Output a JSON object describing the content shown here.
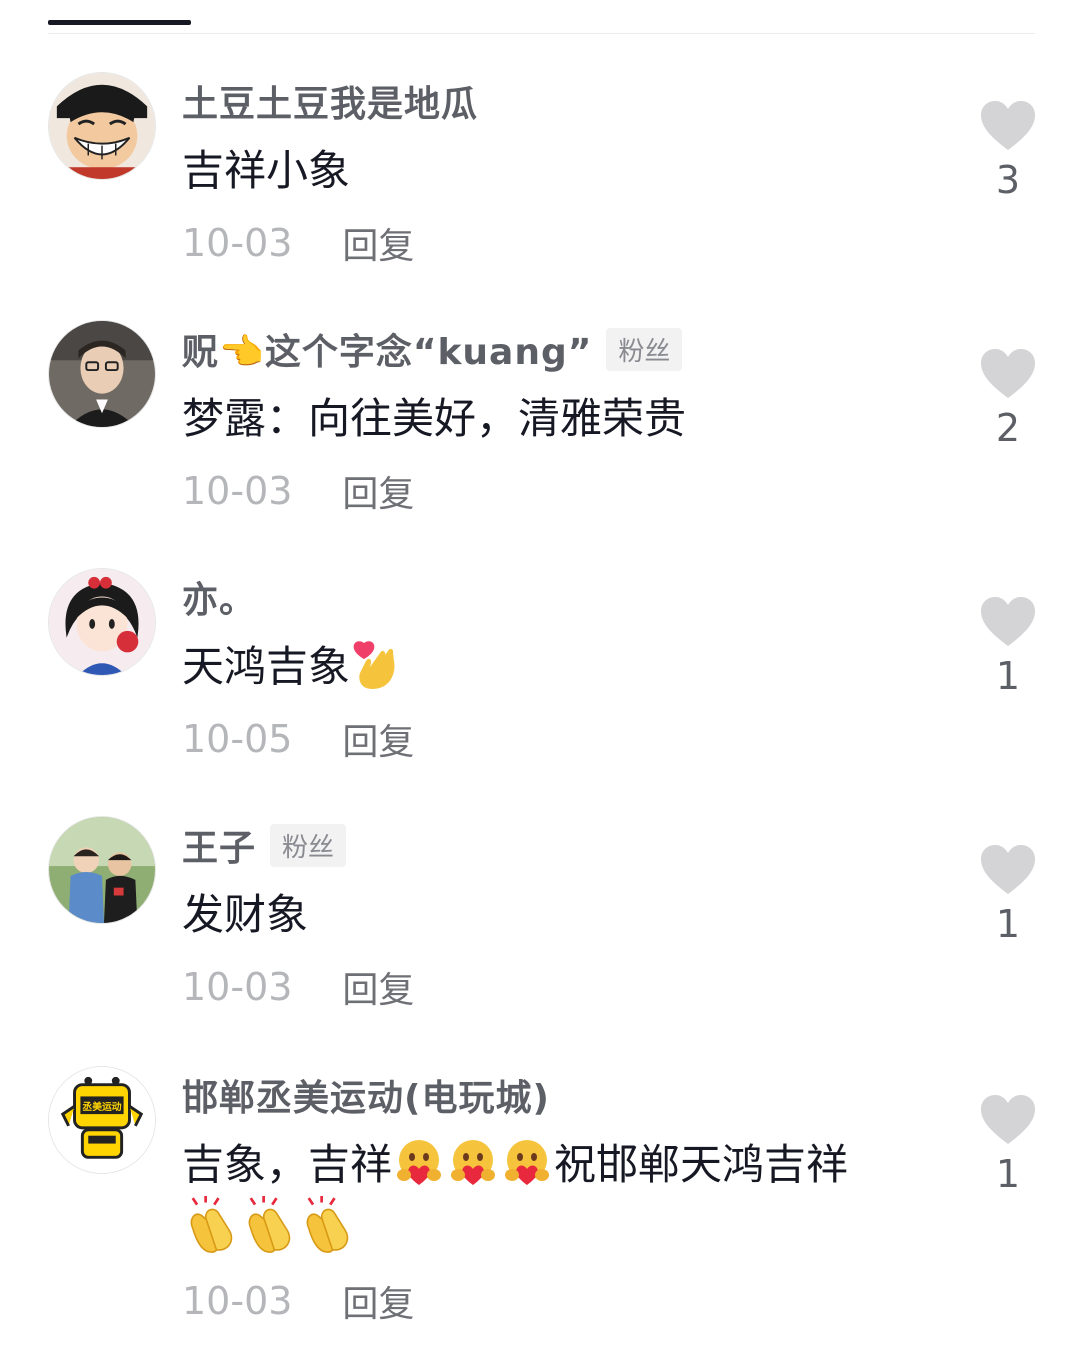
{
  "colors": {
    "username": "#5d5f66",
    "content": "#161823",
    "date": "#b5b6ba",
    "reply": "#6e7076",
    "heart": "#d4d4d6",
    "badge_bg": "#f2f2f2"
  },
  "icons": {
    "like": "heart-icon",
    "emoji_heart_hands": "heart-hands-emoji",
    "emoji_hugging_heart": "hugging-heart-emoji",
    "emoji_clap": "clapping-hands-emoji"
  },
  "comments": [
    {
      "username": "土豆土豆我是地瓜",
      "badge": "",
      "text": "吉祥小象",
      "date": "10-03",
      "reply": "回复",
      "likes": "3"
    },
    {
      "username": "贶👈这个字念“kuang”",
      "badge": "粉丝",
      "text": "梦露：向往美好，清雅荣贵",
      "date": "10-03",
      "reply": "回复",
      "likes": "2"
    },
    {
      "username": "亦。",
      "badge": "",
      "text": "天鸿吉象",
      "date": "10-05",
      "reply": "回复",
      "likes": "1"
    },
    {
      "username": "王子",
      "badge": "粉丝",
      "text": "发财象",
      "date": "10-03",
      "reply": "回复",
      "likes": "1"
    },
    {
      "username": "邯郸丞美运动(电玩城)",
      "badge": "",
      "text_part1": "吉象，吉祥",
      "text_part2": "祝邯郸天鸿吉祥",
      "date": "10-03",
      "reply": "回复",
      "likes": "1",
      "avatar_logo_text": "丞美运动"
    }
  ]
}
